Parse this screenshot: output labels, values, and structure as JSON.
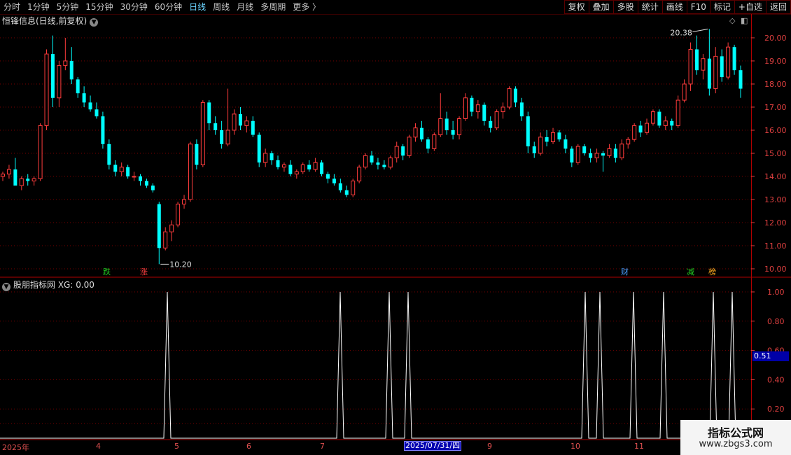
{
  "toolbar": {
    "tabs": [
      "分时",
      "1分钟",
      "5分钟",
      "15分钟",
      "30分钟",
      "60分钟",
      "日线",
      "周线",
      "月线",
      "多周期",
      "更多 〉"
    ],
    "active_tab": "日线",
    "right_buttons": [
      "复权",
      "叠加",
      "多股",
      "统计",
      "画线",
      "F10",
      "标记",
      "+自选",
      "返回"
    ]
  },
  "stock_title": "恒锋信息(日线,前复权)",
  "indicator_title": "股朋指标网  XG: 0.00",
  "current_value": "0.51",
  "price_axis": [
    "20.00",
    "19.00",
    "18.00",
    "17.00",
    "16.00",
    "15.00",
    "14.00",
    "13.00",
    "12.00",
    "11.00",
    "10.00"
  ],
  "indicator_axis": [
    "1.00",
    "0.80",
    "0.60",
    "0.40",
    "0.20"
  ],
  "annotations": {
    "high": "20.38",
    "low": "10.20"
  },
  "badges": [
    {
      "text": "跌",
      "color": "#22cc22"
    },
    {
      "text": "涨",
      "color": "#ff4040"
    },
    {
      "text": "财",
      "color": "#4aa0ff"
    },
    {
      "text": "减",
      "color": "#22cc22"
    },
    {
      "text": "榜",
      "color": "#ffaa20"
    }
  ],
  "date_axis": {
    "labels": [
      "2025年",
      "4",
      "5",
      "6",
      "7",
      "9",
      "10",
      "11"
    ],
    "highlight": "2025/07/31/四"
  },
  "watermark": {
    "title": "指标公式网",
    "url": "www.zbgs3.com"
  },
  "colors": {
    "up": "#ff3c3c",
    "down": "#00ffff",
    "grid": "#7a0000",
    "axis": "#e04040"
  },
  "chart_data": {
    "type": "candlestick",
    "series": [
      {
        "name": "XG",
        "values": [
          0,
          1,
          0,
          1,
          1,
          1,
          0,
          1,
          1,
          1,
          1,
          1,
          0
        ]
      }
    ],
    "price_range": [
      10.0,
      20.38
    ],
    "candles": [
      [
        14.0,
        14.2,
        13.8,
        14.1
      ],
      [
        14.1,
        14.5,
        13.9,
        14.3
      ],
      [
        14.3,
        14.8,
        14.0,
        13.6
      ],
      [
        13.6,
        14.0,
        13.4,
        13.9
      ],
      [
        13.9,
        14.1,
        13.6,
        13.8
      ],
      [
        13.8,
        14.0,
        13.6,
        13.9
      ],
      [
        13.9,
        16.3,
        13.8,
        16.2
      ],
      [
        16.2,
        19.5,
        16.0,
        19.3
      ],
      [
        19.3,
        20.1,
        17.0,
        17.4
      ],
      [
        17.4,
        19.0,
        17.0,
        18.8
      ],
      [
        18.8,
        20.0,
        18.6,
        19.0
      ],
      [
        19.0,
        19.6,
        18.0,
        18.2
      ],
      [
        18.2,
        18.3,
        17.4,
        17.6
      ],
      [
        17.6,
        17.9,
        17.0,
        17.2
      ],
      [
        17.2,
        17.5,
        16.8,
        16.9
      ],
      [
        16.9,
        17.2,
        16.5,
        16.6
      ],
      [
        16.6,
        16.8,
        15.2,
        15.4
      ],
      [
        15.4,
        15.6,
        14.3,
        14.5
      ],
      [
        14.5,
        14.7,
        14.0,
        14.2
      ],
      [
        14.2,
        14.6,
        14.0,
        14.4
      ],
      [
        14.4,
        14.5,
        13.9,
        14.0
      ],
      [
        14.0,
        14.2,
        13.8,
        14.0
      ],
      [
        14.0,
        14.1,
        13.6,
        13.8
      ],
      [
        13.8,
        13.9,
        13.5,
        13.6
      ],
      [
        13.6,
        13.7,
        13.3,
        13.4
      ],
      [
        12.8,
        12.9,
        10.2,
        10.9
      ],
      [
        10.9,
        11.8,
        10.8,
        11.6
      ],
      [
        11.6,
        12.1,
        11.2,
        11.9
      ],
      [
        11.9,
        12.9,
        11.8,
        12.8
      ],
      [
        12.8,
        13.2,
        12.6,
        13.0
      ],
      [
        13.0,
        15.5,
        12.9,
        15.4
      ],
      [
        15.4,
        15.6,
        14.3,
        14.5
      ],
      [
        14.5,
        17.3,
        14.4,
        17.2
      ],
      [
        17.2,
        17.3,
        16.0,
        16.3
      ],
      [
        16.3,
        16.6,
        15.8,
        16.0
      ],
      [
        16.0,
        16.4,
        15.2,
        15.4
      ],
      [
        15.4,
        17.8,
        15.3,
        16.0
      ],
      [
        16.0,
        16.9,
        15.8,
        16.7
      ],
      [
        16.7,
        17.0,
        16.0,
        16.2
      ],
      [
        16.2,
        16.6,
        15.9,
        16.4
      ],
      [
        16.4,
        16.6,
        15.7,
        15.8
      ],
      [
        15.8,
        15.9,
        14.4,
        14.6
      ],
      [
        14.6,
        15.2,
        14.4,
        15.0
      ],
      [
        15.0,
        15.1,
        14.5,
        14.7
      ],
      [
        14.7,
        14.9,
        14.3,
        14.4
      ],
      [
        14.4,
        14.6,
        14.2,
        14.5
      ],
      [
        14.5,
        14.7,
        14.0,
        14.1
      ],
      [
        14.1,
        14.3,
        13.9,
        14.2
      ],
      [
        14.2,
        14.6,
        14.1,
        14.5
      ],
      [
        14.5,
        14.7,
        14.2,
        14.3
      ],
      [
        14.3,
        14.8,
        14.2,
        14.6
      ],
      [
        14.6,
        14.7,
        14.0,
        14.1
      ],
      [
        14.1,
        14.2,
        13.7,
        13.9
      ],
      [
        13.9,
        14.1,
        13.6,
        13.7
      ],
      [
        13.7,
        13.9,
        13.3,
        13.4
      ],
      [
        13.4,
        13.6,
        13.1,
        13.2
      ],
      [
        13.2,
        13.9,
        13.1,
        13.8
      ],
      [
        13.8,
        14.5,
        13.7,
        14.4
      ],
      [
        14.4,
        15.0,
        14.3,
        14.9
      ],
      [
        14.9,
        15.1,
        14.5,
        14.6
      ],
      [
        14.6,
        14.8,
        14.3,
        14.5
      ],
      [
        14.5,
        14.7,
        14.3,
        14.4
      ],
      [
        14.4,
        14.9,
        14.3,
        14.8
      ],
      [
        14.8,
        15.5,
        14.6,
        15.3
      ],
      [
        15.3,
        15.4,
        14.7,
        14.9
      ],
      [
        14.9,
        15.8,
        14.8,
        15.7
      ],
      [
        15.7,
        16.3,
        15.5,
        16.1
      ],
      [
        16.1,
        16.4,
        15.5,
        15.6
      ],
      [
        15.6,
        15.7,
        15.0,
        15.2
      ],
      [
        15.2,
        15.9,
        15.1,
        15.8
      ],
      [
        15.8,
        17.6,
        15.7,
        16.5
      ],
      [
        16.5,
        16.8,
        15.8,
        16.0
      ],
      [
        16.0,
        16.4,
        15.6,
        15.8
      ],
      [
        15.8,
        16.6,
        15.6,
        16.5
      ],
      [
        16.5,
        17.6,
        16.4,
        17.4
      ],
      [
        17.4,
        17.5,
        16.6,
        16.8
      ],
      [
        16.8,
        17.3,
        16.5,
        17.1
      ],
      [
        17.1,
        17.2,
        16.2,
        16.4
      ],
      [
        16.4,
        16.6,
        15.9,
        16.1
      ],
      [
        16.1,
        16.9,
        16.0,
        16.8
      ],
      [
        16.8,
        17.2,
        16.5,
        17.0
      ],
      [
        17.0,
        17.9,
        16.9,
        17.8
      ],
      [
        17.8,
        17.9,
        17.0,
        17.2
      ],
      [
        17.2,
        17.4,
        16.4,
        16.6
      ],
      [
        16.6,
        16.8,
        15.0,
        15.3
      ],
      [
        15.3,
        15.5,
        14.8,
        15.0
      ],
      [
        15.0,
        15.9,
        14.9,
        15.7
      ],
      [
        15.7,
        16.0,
        15.3,
        15.5
      ],
      [
        15.5,
        16.1,
        15.4,
        15.9
      ],
      [
        15.9,
        16.0,
        15.5,
        15.6
      ],
      [
        15.6,
        15.8,
        15.0,
        15.2
      ],
      [
        15.2,
        15.3,
        14.4,
        14.6
      ],
      [
        14.6,
        15.4,
        14.5,
        15.3
      ],
      [
        15.3,
        15.4,
        14.9,
        15.0
      ],
      [
        15.0,
        15.2,
        14.6,
        14.8
      ],
      [
        14.8,
        15.2,
        14.6,
        15.0
      ],
      [
        15.0,
        15.1,
        14.2,
        14.9
      ],
      [
        14.9,
        15.4,
        14.8,
        15.2
      ],
      [
        15.2,
        15.4,
        14.6,
        14.8
      ],
      [
        14.8,
        15.6,
        14.7,
        15.4
      ],
      [
        15.4,
        15.7,
        15.2,
        15.6
      ],
      [
        15.6,
        16.3,
        15.5,
        16.2
      ],
      [
        16.2,
        16.4,
        15.7,
        15.9
      ],
      [
        15.9,
        16.5,
        15.8,
        16.3
      ],
      [
        16.3,
        16.9,
        16.2,
        16.8
      ],
      [
        16.8,
        16.9,
        16.1,
        16.2
      ],
      [
        16.2,
        16.6,
        16.0,
        16.4
      ],
      [
        16.4,
        16.5,
        16.0,
        16.2
      ],
      [
        16.2,
        17.5,
        16.1,
        17.3
      ],
      [
        17.3,
        18.2,
        17.2,
        18.0
      ],
      [
        18.0,
        19.8,
        17.7,
        19.5
      ],
      [
        19.5,
        20.1,
        18.4,
        18.6
      ],
      [
        18.6,
        19.3,
        18.2,
        19.1
      ],
      [
        19.1,
        20.38,
        17.5,
        17.8
      ],
      [
        17.8,
        19.6,
        17.6,
        19.2
      ],
      [
        19.2,
        19.5,
        18.1,
        18.3
      ],
      [
        18.3,
        19.8,
        18.2,
        19.6
      ],
      [
        19.6,
        19.7,
        18.4,
        18.6
      ],
      [
        18.6,
        18.8,
        17.4,
        17.8
      ]
    ]
  }
}
